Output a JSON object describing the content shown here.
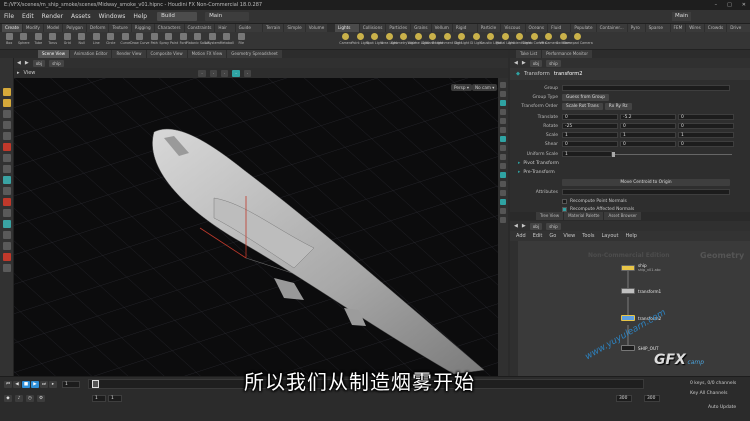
{
  "window": {
    "title": "E:/VFX/scenes/m_ship_smoke/scenes/Midway_smoke_v01.hipnc - Houdini FX Non-Commercial 18.0.287",
    "controls": [
      "–",
      "□",
      "✕"
    ]
  },
  "menu": {
    "items": [
      "File",
      "Edit",
      "Render",
      "Assets",
      "Windows",
      "Help"
    ],
    "desktop_build": "Build",
    "desktop_main": "Main"
  },
  "shelf": {
    "tabs_left": [
      "Create",
      "Modify",
      "Model",
      "Polygon",
      "Deform",
      "Texture",
      "Rigging",
      "Characters",
      "Constraints",
      "Hair Utils",
      "Guide Process",
      "Terrain FX",
      "Simple FX",
      "Volume"
    ],
    "tabs_right": [
      "Lights and...",
      "Collisions",
      "Particles",
      "Grains",
      "Vellum",
      "Rigid Bodies",
      "Particle Fl...",
      "Viscous Fl...",
      "Oceans",
      "Fluid Con...",
      "Populate C...",
      "Container...",
      "Pyro FX",
      "Sparse Pyr...",
      "FEM",
      "Wires",
      "Crowds",
      "Drive Sim..."
    ],
    "tools_left": [
      "Box",
      "Sphere",
      "Tube",
      "Torus",
      "Grid",
      "Null",
      "Line",
      "Circle",
      "Curve",
      "Draw Curve",
      "Path",
      "Spray Paint",
      "Font",
      "Platonic Solids",
      "L-System",
      "Metaball",
      "File"
    ],
    "tools_right": [
      "Camera",
      "Point Light",
      "Spot Light",
      "Area Light",
      "Geometry Light",
      "Volume Light",
      "Distant Light",
      "Environment Light",
      "Sky Light",
      "GI Light",
      "Caustic Light",
      "Portal Light",
      "Ambient Light",
      "Stereo Camera",
      "VR Camera",
      "Switcher",
      "Gamepad Camera"
    ]
  },
  "pane_tabs": {
    "left": [
      "Scene View",
      "Animation Editor",
      "Render View",
      "Composite View",
      "Motion FX View",
      "Geometry Spreadsheet"
    ],
    "right": [
      "Take List",
      "Performance Monitor"
    ]
  },
  "viewer": {
    "path_obj": "obj",
    "path_node": "ship",
    "tab_label": "View",
    "persp_label": "Persp ▾",
    "cam_label": "No cam ▾"
  },
  "params": {
    "path_obj": "obj",
    "path_node": "ship",
    "node_type": "Transform",
    "node_name": "transform2",
    "group_label": "Group",
    "group_type_label": "Group Type",
    "group_type_value": "Guess from Group",
    "transform_order_label": "Transform Order",
    "transform_order_value": "Scale Rot Trans",
    "rot_order_value": "Rx Ry Rz",
    "translate_label": "Translate",
    "translate": [
      "0",
      "-5.2",
      "0"
    ],
    "rotate_label": "Rotate",
    "rotate": [
      "-25",
      "0",
      "0"
    ],
    "scale_label": "Scale",
    "scale": [
      "1",
      "1",
      "1"
    ],
    "shear_label": "Shear",
    "shear": [
      "0",
      "0",
      "0"
    ],
    "uniform_scale_label": "Uniform Scale",
    "uniform_scale": "1",
    "pivot_label": "Pivot Transform",
    "pre_label": "Pre-Transform",
    "move_centroid_label": "Move Centroid to Origin",
    "attributes_label": "Attributes",
    "recompute_normals_label": "Recompute Point Normals",
    "recompute_affected_label": "Recompute Affected Normals"
  },
  "network": {
    "tabs": [
      "Tree View",
      "Material Palette",
      "Asset Browser"
    ],
    "path_obj": "obj",
    "path_node": "ship",
    "menu": [
      "Add",
      "Edit",
      "Go",
      "View",
      "Tools",
      "Layout",
      "Help"
    ],
    "bg_label_1": "Non-Commercial Edition",
    "bg_label_2": "Geometry",
    "nodes": [
      {
        "label": "ship",
        "sub": "ship_v01.abc"
      },
      {
        "label": "transform1",
        "sub": ""
      },
      {
        "label": "transform2",
        "sub": ""
      },
      {
        "label": "SHIP_OUT",
        "sub": ""
      }
    ]
  },
  "timeline": {
    "frame": "1",
    "start": "1",
    "start2": "1",
    "end": "300",
    "end2": "300",
    "channels": "0 keys, 0/0 channels",
    "key_all": "Key All Channels",
    "auto_update": "Auto Update"
  },
  "subtitle": "所以我们从制造烟雾开始",
  "watermark": {
    "brand": "GFX",
    "sub": "camp",
    "url": "www.yuyulearn.com"
  },
  "colors": {
    "teal": "#2fa3a3",
    "node_sel": "#e8c547",
    "node_blue": "#5d9fe0"
  }
}
